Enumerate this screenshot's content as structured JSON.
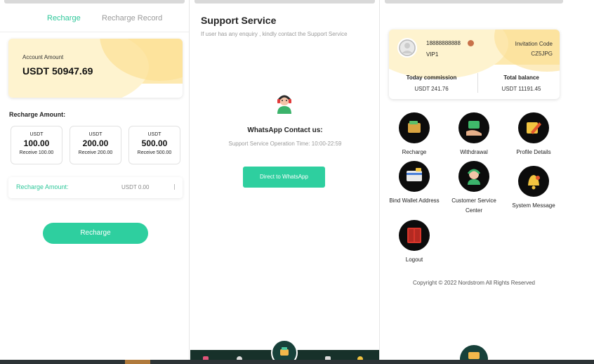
{
  "recharge_panel": {
    "tabs": [
      {
        "label": "Recharge",
        "active": true
      },
      {
        "label": "Recharge Record",
        "active": false
      }
    ],
    "account": {
      "label": "Account Amount",
      "value": "USDT 50947.69"
    },
    "amount_section_title": "Recharge Amount:",
    "amount_options": [
      {
        "unit": "USDT",
        "amount": "100.00",
        "receive": "Receive 100.00"
      },
      {
        "unit": "USDT",
        "amount": "200.00",
        "receive": "Receive 200.00"
      },
      {
        "unit": "USDT",
        "amount": "500.00",
        "receive": "Receive 500.00"
      }
    ],
    "input": {
      "label": "Recharge Amount:",
      "value": "USDT 0.00"
    },
    "button_label": "Recharge"
  },
  "support_panel": {
    "title": "Support Service",
    "subtitle": "If user has any enquiry , kindly contact the Support Service",
    "whatsapp_title": "WhatsApp Contact us:",
    "operation_time": "Support Service Operation Time: 10:00-22:59",
    "button_label": "Direct to WhatsApp"
  },
  "profile_panel": {
    "phone": "18888888888",
    "vip": "VIP1",
    "invitation_label": "Invitation Code",
    "invitation_code": "CZ5JPG",
    "stats": [
      {
        "label": "Today commission",
        "value": "USDT 241.76"
      },
      {
        "label": "Total balance",
        "value": "USDT 11191.45"
      }
    ],
    "menu": [
      {
        "label": "Recharge",
        "icon": "wallet-icon"
      },
      {
        "label": "Withdrawal",
        "icon": "money-hand-icon"
      },
      {
        "label": "Profile Details",
        "icon": "edit-pencil-icon"
      },
      {
        "label": "Bind Wallet Address",
        "icon": "card-icon"
      },
      {
        "label": "Customer Service Center",
        "icon": "agent-icon"
      },
      {
        "label": "System Message",
        "icon": "bell-icon"
      },
      {
        "label": "Logout",
        "icon": "logout-door-icon"
      }
    ],
    "copyright": "Copyright © 2022 Nordstrom All Rights Reserved"
  },
  "colors": {
    "accent": "#2ecf9f",
    "card_gold": "#fde9b0",
    "dark_nav": "#17312a"
  }
}
